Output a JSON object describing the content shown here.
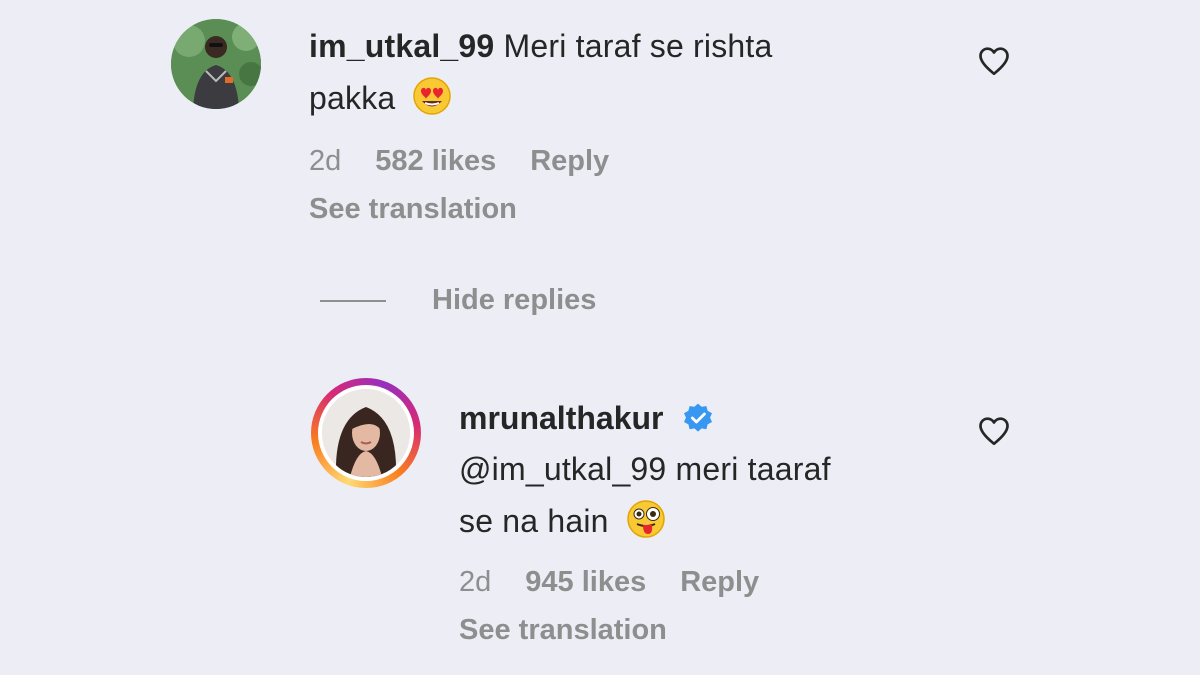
{
  "comments": [
    {
      "username": "im_utkal_99",
      "text_line1": "Meri taraf se rishta",
      "text_line2": "pakka",
      "emoji": "heart-eyes-emoji",
      "time": "2d",
      "likes": "582 likes",
      "reply_label": "Reply",
      "translation_label": "See translation",
      "liked": false
    }
  ],
  "hide_replies_label": "Hide replies",
  "replies": [
    {
      "username": "mrunalthakur",
      "verified": true,
      "text_line1": "@im_utkal_99 meri taaraf",
      "text_line2": "se na hain",
      "emoji": "winking-tongue-emoji",
      "time": "2d",
      "likes": "945 likes",
      "reply_label": "Reply",
      "translation_label": "See translation",
      "liked": false
    }
  ],
  "colors": {
    "background": "#ededf5",
    "text_primary": "#262626",
    "text_secondary": "#8e8e8e",
    "verified_blue": "#3897f0"
  }
}
